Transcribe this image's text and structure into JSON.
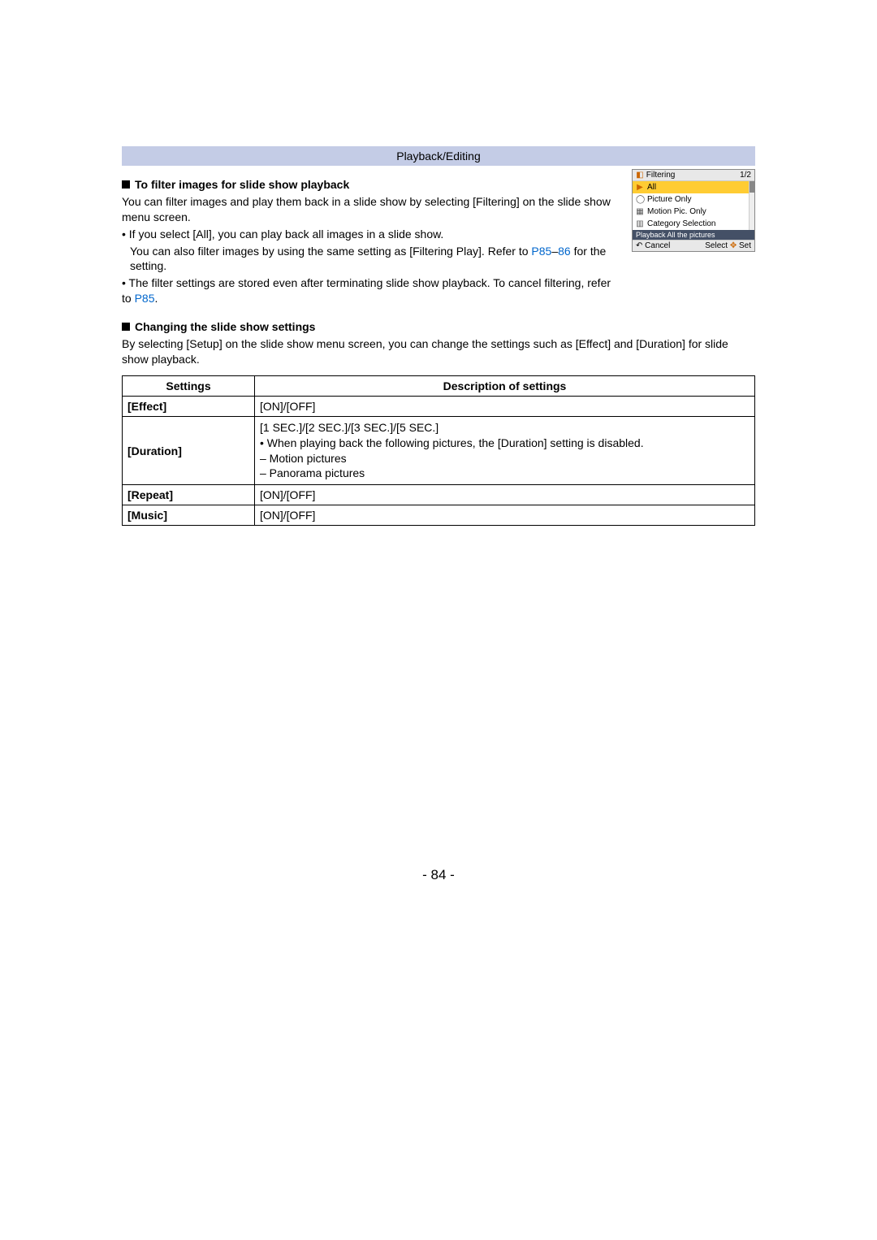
{
  "banner": "Playback/Editing",
  "section1": {
    "title": "To filter images for slide show playback",
    "intro1": "You can filter images and play them back in a slide show by selecting [Filtering] on the slide show menu screen.",
    "b1a": "If you select [All], you can play back all images in a slide show.",
    "b1b_pre": "You can also filter images by using the same setting as [Filtering Play]. Refer to ",
    "b1b_link1": "P85",
    "b1b_dash": "–",
    "b1b_link2": "86",
    "b1b_post": " for the setting.",
    "b2_pre": "The filter settings are stored even after terminating slide show playback. To cancel filtering, refer to ",
    "b2_link": "P85",
    "b2_post": "."
  },
  "screenshot": {
    "title": "Filtering",
    "page": "1/2",
    "item_all": "All",
    "item_pic": "Picture Only",
    "item_mot": "Motion Pic. Only",
    "item_cat": "Category Selection",
    "status": "Playback All the pictures",
    "cancel": "Cancel",
    "select": "Select",
    "set": "Set"
  },
  "section2": {
    "title": "Changing the slide show settings",
    "intro": "By selecting [Setup] on the slide show menu screen, you can change the settings such as [Effect] and [Duration] for slide show playback."
  },
  "table": {
    "h1": "Settings",
    "h2": "Description of settings",
    "row_effect_label": "[Effect]",
    "row_effect_val": "[ON]/[OFF]",
    "row_duration_label": "[Duration]",
    "dur_line1": "[1 SEC.]/[2 SEC.]/[3 SEC.]/[5 SEC.]",
    "dur_line2": "• When playing back the following pictures, the [Duration] setting is disabled.",
    "dur_line3": "– Motion pictures",
    "dur_line4": "– Panorama pictures",
    "row_repeat_label": "[Repeat]",
    "row_repeat_val": "[ON]/[OFF]",
    "row_music_label": "[Music]",
    "row_music_val": "[ON]/[OFF]"
  },
  "page_number": "- 84 -"
}
